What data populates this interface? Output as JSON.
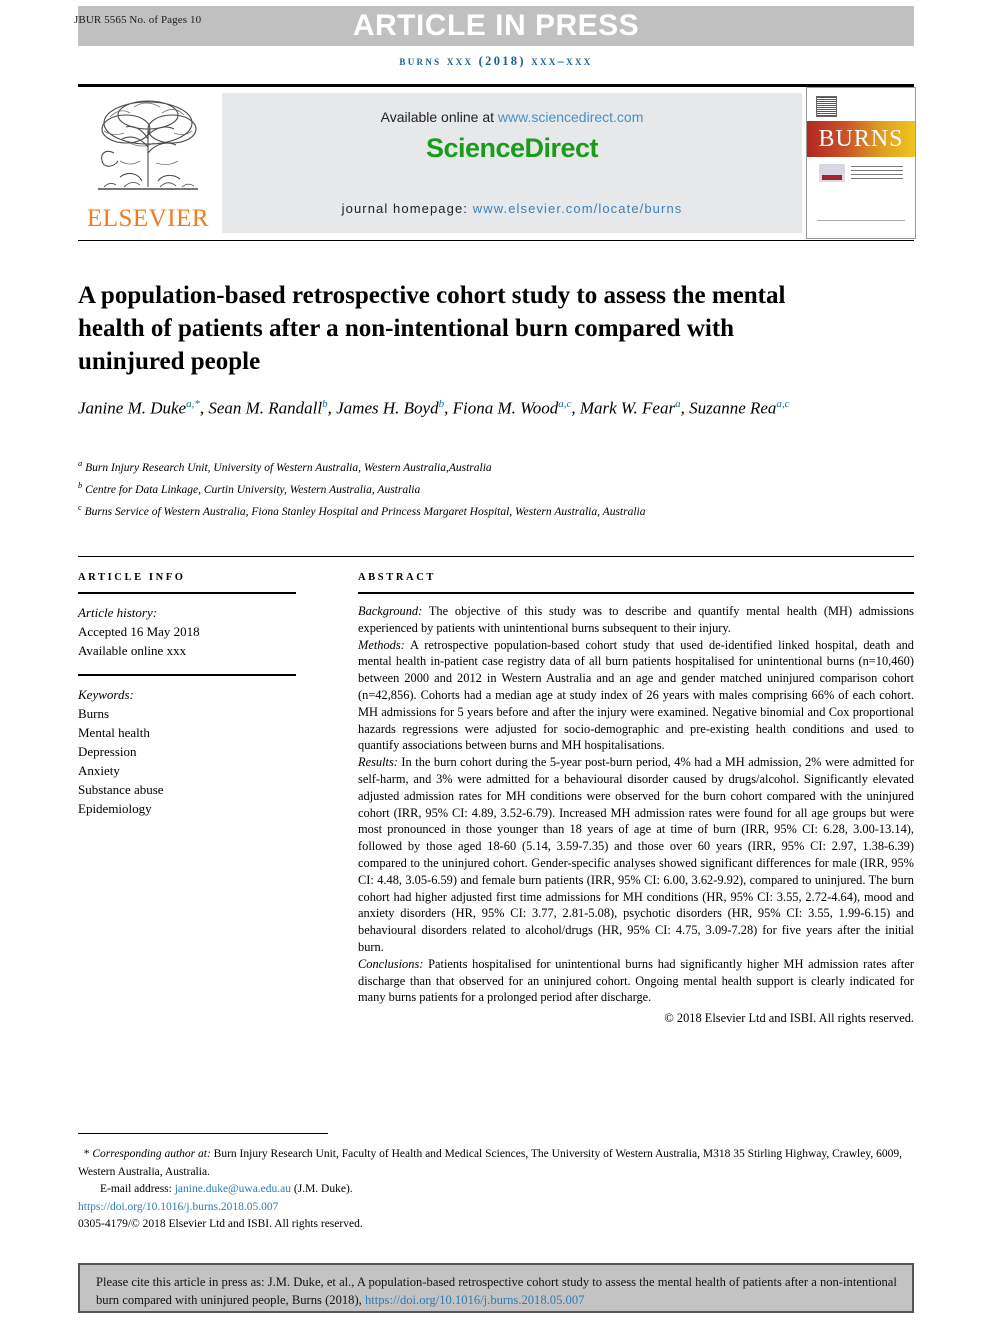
{
  "header": {
    "article_id": "JBUR 5565 No. of Pages 10",
    "banner_text": "ARTICLE IN PRESS",
    "journal_line": "burns xxx (2018) xxx–xxx"
  },
  "publisher_strip": {
    "elsevier_wordmark": "ELSEVIER",
    "available_online_prefix": "Available online at ",
    "sciencedirect_url": "www.sciencedirect.com",
    "sciencedirect_logo": "ScienceDirect",
    "journal_homepage_prefix": "journal homepage: ",
    "journal_homepage_url": "www.elsevier.com/locate/burns",
    "cover_title": "BURNS"
  },
  "article": {
    "title": "A population-based retrospective cohort study to assess the mental health of patients after a non-intentional burn compared with uninjured people",
    "authors_line_1": "Janine M. Duke",
    "authors": [
      {
        "name": "Janine M. Duke",
        "marks": "a,*"
      },
      {
        "name": "Sean M. Randall",
        "marks": "b"
      },
      {
        "name": "James H. Boyd",
        "marks": "b"
      },
      {
        "name": "Fiona M. Wood",
        "marks": "a,c"
      },
      {
        "name": "Mark W. Fear",
        "marks": "a"
      },
      {
        "name": "Suzanne Rea",
        "marks": "a,c"
      }
    ],
    "affiliations": [
      {
        "mark": "a",
        "text": "Burn Injury Research Unit, University of Western Australia, Western Australia,Australia"
      },
      {
        "mark": "b",
        "text": "Centre for Data Linkage, Curtin University, Western Australia, Australia"
      },
      {
        "mark": "c",
        "text": "Burns Service of Western Australia, Fiona Stanley Hospital and Princess Margaret Hospital, Western Australia, Australia"
      }
    ]
  },
  "article_info": {
    "heading": "ARTICLE INFO",
    "history_label": "Article history:",
    "accepted": "Accepted 16 May 2018",
    "available_online": "Available online xxx",
    "keywords_label": "Keywords:",
    "keywords": [
      "Burns",
      "Mental health",
      "Depression",
      "Anxiety",
      "Substance abuse",
      "Epidemiology"
    ]
  },
  "abstract": {
    "heading": "ABSTRACT",
    "background_label": "Background:",
    "background_text": " The objective of this study was to describe and quantify mental health (MH) admissions experienced by patients with unintentional burns subsequent to their injury.",
    "methods_label": "Methods:",
    "methods_text": " A retrospective population-based cohort study that used de-identified linked hospital, death and mental health in-patient case registry data of all burn patients hospitalised for unintentional burns (n=10,460) between 2000 and 2012 in Western Australia and an age and gender matched uninjured comparison cohort (n=42,856). Cohorts had a median age at study index of 26 years with males comprising 66% of each cohort. MH admissions for 5 years before and after the injury were examined. Negative binomial and Cox proportional hazards regressions were adjusted for socio-demographic and pre-existing health conditions and used to quantify associations between burns and MH hospitalisations.",
    "results_label": "Results:",
    "results_text": " In the burn cohort during the 5-year post-burn period, 4% had a MH admission, 2% were admitted for self-harm, and 3% were admitted for a behavioural disorder caused by drugs/alcohol. Significantly elevated adjusted admission rates for MH conditions were observed for the burn cohort compared with the uninjured cohort (IRR, 95% CI: 4.89, 3.52-6.79). Increased MH admission rates were found for all age groups but were most pronounced in those younger than 18 years of age at time of burn (IRR, 95% CI: 6.28, 3.00-13.14), followed by those aged 18-60 (5.14, 3.59-7.35) and those over 60 years (IRR, 95% CI: 2.97, 1.38-6.39) compared to the uninjured cohort. Gender-specific analyses showed significant differences for male (IRR, 95% CI: 4.48, 3.05-6.59) and female burn patients (IRR, 95% CI: 6.00, 3.62-9.92), compared to uninjured. The burn cohort had higher adjusted first time admissions for MH conditions (HR, 95% CI: 3.55, 2.72-4.64), mood and anxiety disorders (HR, 95% CI: 3.77, 2.81-5.08), psychotic disorders (HR, 95% CI: 3.55, 1.99-6.15) and behavioural disorders related to alcohol/drugs (HR, 95% CI: 4.75, 3.09-7.28) for five years after the initial burn.",
    "conclusions_label": "Conclusions:",
    "conclusions_text": " Patients hospitalised for unintentional burns had significantly higher MH admission rates after discharge than that observed for an uninjured cohort. Ongoing mental health support is clearly indicated for many burns patients for a prolonged period after discharge.",
    "copyright": "© 2018 Elsevier Ltd and ISBI. All rights reserved."
  },
  "footnotes": {
    "corresponding_label": "Corresponding author at:",
    "corresponding_text": " Burn Injury Research Unit, Faculty of Health and Medical Sciences, The University of Western Australia, M318 35 Stirling Highway, Crawley, 6009, Western Australia, Australia.",
    "email_label": "E-mail address: ",
    "email": "janine.duke@uwa.edu.au",
    "email_suffix": " (J.M.  Duke).",
    "doi": "https://doi.org/10.1016/j.burns.2018.05.007",
    "issn_line": "0305-4179/© 2018 Elsevier Ltd and ISBI. All rights reserved."
  },
  "cite_box": {
    "text": "Please cite this article in press as: J.M. Duke, et al., A population-based retrospective cohort study to assess the mental health of patients after a non-intentional burn compared with uninjured people, Burns (2018), ",
    "link": "https://doi.org/10.1016/j.burns.2018.05.007"
  },
  "colors": {
    "banner_grey": "#c0c0c0",
    "journal_blue": "#17628e",
    "link_blue": "#2e7cb0",
    "sciencedirect_green": "#1a9c1a",
    "elsevier_orange": "#f07c1a",
    "cite_box_grey": "#c3c3c3"
  }
}
